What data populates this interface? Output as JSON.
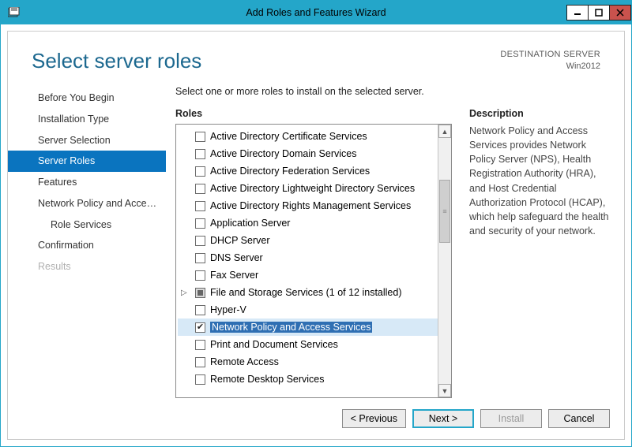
{
  "window": {
    "title": "Add Roles and Features Wizard"
  },
  "header": {
    "page_title": "Select server roles",
    "destination_label": "DESTINATION SERVER",
    "destination_server": "Win2012"
  },
  "sidebar": {
    "items": [
      {
        "label": "Before You Begin",
        "active": false
      },
      {
        "label": "Installation Type",
        "active": false
      },
      {
        "label": "Server Selection",
        "active": false
      },
      {
        "label": "Server Roles",
        "active": true
      },
      {
        "label": "Features",
        "active": false
      },
      {
        "label": "Network Policy and Acces...",
        "active": false
      },
      {
        "label": "Role Services",
        "active": false,
        "sub": true
      },
      {
        "label": "Confirmation",
        "active": false
      },
      {
        "label": "Results",
        "active": false,
        "disabled": true
      }
    ]
  },
  "main": {
    "instruction": "Select one or more roles to install on the selected server.",
    "roles_label": "Roles",
    "description_label": "Description",
    "description_text": "Network Policy and Access Services provides Network Policy Server (NPS), Health Registration Authority (HRA), and Host Credential Authorization Protocol (HCAP), which help safeguard the health and security of your network.",
    "roles": [
      {
        "label": "Active Directory Certificate Services",
        "state": "unchecked"
      },
      {
        "label": "Active Directory Domain Services",
        "state": "unchecked"
      },
      {
        "label": "Active Directory Federation Services",
        "state": "unchecked"
      },
      {
        "label": "Active Directory Lightweight Directory Services",
        "state": "unchecked"
      },
      {
        "label": "Active Directory Rights Management Services",
        "state": "unchecked"
      },
      {
        "label": "Application Server",
        "state": "unchecked"
      },
      {
        "label": "DHCP Server",
        "state": "unchecked"
      },
      {
        "label": "DNS Server",
        "state": "unchecked"
      },
      {
        "label": "Fax Server",
        "state": "unchecked"
      },
      {
        "label": "File and Storage Services (1 of 12 installed)",
        "state": "indeterminate",
        "expandable": true
      },
      {
        "label": "Hyper-V",
        "state": "unchecked"
      },
      {
        "label": "Network Policy and Access Services",
        "state": "checked",
        "selected": true
      },
      {
        "label": "Print and Document Services",
        "state": "unchecked"
      },
      {
        "label": "Remote Access",
        "state": "unchecked"
      },
      {
        "label": "Remote Desktop Services",
        "state": "unchecked"
      }
    ]
  },
  "footer": {
    "previous": "< Previous",
    "next": "Next >",
    "install": "Install",
    "cancel": "Cancel"
  }
}
